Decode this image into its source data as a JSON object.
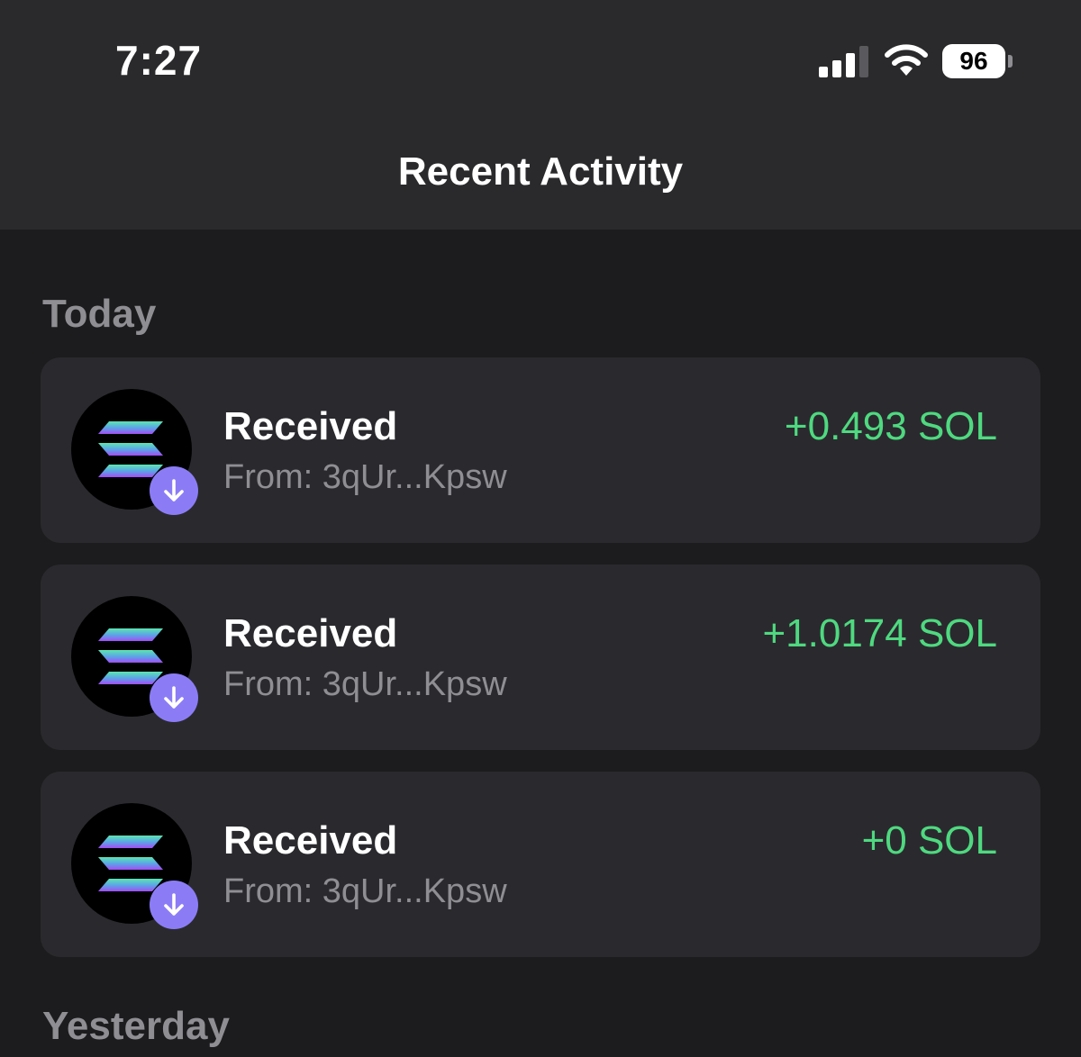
{
  "status_bar": {
    "time": "7:27",
    "battery": "96",
    "icons": [
      "signal-icon",
      "wifi-icon",
      "battery-icon"
    ]
  },
  "header": {
    "title": "Recent Activity"
  },
  "sections": [
    {
      "label": "Today",
      "items": [
        {
          "title": "Received",
          "subtitle": "From: 3qUr...Kpsw",
          "amount": "+0.493 SOL",
          "icon": "solana-logo-icon",
          "badge_icon": "arrow-down-icon"
        },
        {
          "title": "Received",
          "subtitle": "From: 3qUr...Kpsw",
          "amount": "+1.0174 SOL",
          "icon": "solana-logo-icon",
          "badge_icon": "arrow-down-icon"
        },
        {
          "title": "Received",
          "subtitle": "From: 3qUr...Kpsw",
          "amount": "+0 SOL",
          "icon": "solana-logo-icon",
          "badge_icon": "arrow-down-icon"
        }
      ]
    },
    {
      "label": "Yesterday",
      "items": []
    }
  ],
  "colors": {
    "background": "#1c1c1e",
    "header_background": "#2a2a2c",
    "card_background": "#2a2a2e",
    "amount_positive": "#4fd980",
    "badge": "#8b7cf6",
    "secondary_text": "#8e8e93"
  }
}
